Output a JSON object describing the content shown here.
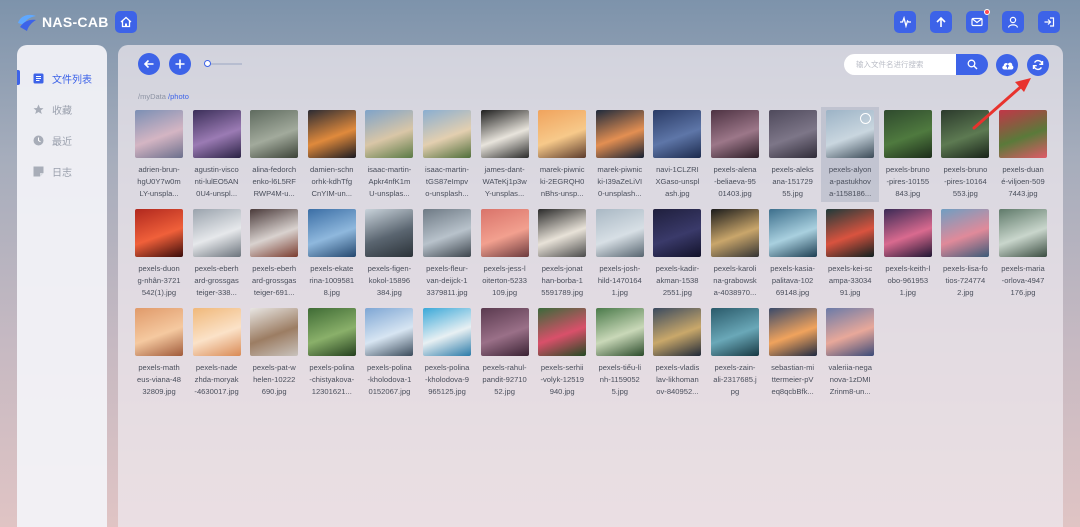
{
  "app": {
    "title": "NAS-CAB"
  },
  "sidebar": {
    "items": [
      {
        "label": "文件列表",
        "icon": "file-list-icon",
        "active": true
      },
      {
        "label": "收藏",
        "icon": "star-icon",
        "active": false
      },
      {
        "label": "最近",
        "icon": "clock-icon",
        "active": false
      },
      {
        "label": "日志",
        "icon": "log-icon",
        "active": false
      }
    ]
  },
  "toolbar": {
    "search_placeholder": "输入文件名进行搜索"
  },
  "breadcrumb": {
    "root": "/myData",
    "current": "/photo"
  },
  "colors": {
    "accent": "#3d63e8",
    "badge": "#ff4d4f"
  },
  "files": [
    {
      "name": "adrien-brun-hgU0Y7w0mLY-unsplash.jpg",
      "caption": [
        "adrien-brun-",
        "hgU0Y7w0m",
        "LY-unspla..."
      ],
      "colors": [
        "#7b8fb4",
        "#d4b5c3",
        "#6b6f8c"
      ]
    },
    {
      "name": "agustin-visconti-lulEO5AN0U4-unsplash.jpg",
      "caption": [
        "agustin-visco",
        "nti-lulEO5AN",
        "0U4-unspl..."
      ],
      "colors": [
        "#3b2f59",
        "#9b7bb4",
        "#2a2244"
      ]
    },
    {
      "name": "alina-fedorchenko-l6L5RFRWP4M-unsplash.jpg",
      "caption": [
        "alina-fedorch",
        "enko-l6L5RF",
        "RWP4M-u..."
      ],
      "colors": [
        "#5f6b5f",
        "#a2aa9c",
        "#3b4237"
      ]
    },
    {
      "name": "damien-schnorhk-kdhTfgCnYIM-unsplash.jpg",
      "caption": [
        "damien-schn",
        "orhk-kdhTfg",
        "CnYIM-un..."
      ],
      "colors": [
        "#2b2b33",
        "#e08a3c",
        "#1a1a22"
      ]
    },
    {
      "name": "isaac-martin-Apkr4nfK1mU-unsplash.jpg",
      "caption": [
        "isaac-martin-",
        "Apkr4nfK1m",
        "U-unsplas..."
      ],
      "colors": [
        "#7fa3c9",
        "#d9c6a7",
        "#5a7a45"
      ]
    },
    {
      "name": "isaac-martin-tGS87eImpvo-unsplash.jpg",
      "caption": [
        "isaac-martin-",
        "tGS87eImpv",
        "o-unsplash..."
      ],
      "colors": [
        "#8aaed1",
        "#e3cfb0",
        "#4f6e3a"
      ]
    },
    {
      "name": "james-dant-WATeKj1p3wY-unsplash.jpg",
      "caption": [
        "james-dant-",
        "WATeKj1p3w",
        "Y-unsplas..."
      ],
      "colors": [
        "#1f1f1f",
        "#e8e4dc",
        "#2a2a2a"
      ]
    },
    {
      "name": "marek-piwnicki-2EGRQH0nBhs-unsplash.jpg",
      "caption": [
        "marek-piwnic",
        "ki-2EGRQH0",
        "nBhs-unsp..."
      ],
      "colors": [
        "#f0a35d",
        "#f7c98a",
        "#5b3b2d"
      ]
    },
    {
      "name": "marek-piwnicki-I39aZeLiVI0-unsplash.jpg",
      "caption": [
        "marek-piwnic",
        "ki-I39aZeLiVI",
        "0-unsplash..."
      ],
      "colors": [
        "#1e2a3c",
        "#e38f52",
        "#152033"
      ]
    },
    {
      "name": "navi-1CLZRIXGaso-unsplash.jpg",
      "caption": [
        "navi-1CLZRI",
        "XGaso-unspl",
        "ash.jpg"
      ],
      "colors": [
        "#2a3b66",
        "#5e76a8",
        "#1c2a4d"
      ]
    },
    {
      "name": "pexels-alena-beliaeva-9501403.jpg",
      "caption": [
        "pexels-alena",
        "-beliaeva-95",
        "01403.jpg"
      ],
      "colors": [
        "#4d3242",
        "#9c7789",
        "#2c1d27"
      ]
    },
    {
      "name": "pexels-aleksana-15172955.jpg",
      "caption": [
        "pexels-aleks",
        "ana-151729",
        "55.jpg"
      ],
      "colors": [
        "#4f4a5c",
        "#7d7688",
        "#2f2b38"
      ]
    },
    {
      "name": "pexels-alyona-pastukhova-1158186.jpg",
      "caption": [
        "pexels-alyon",
        "a-pastukhov",
        "a-1158186..."
      ],
      "colors": [
        "#9cb3c6",
        "#c9d6df",
        "#3b4a57"
      ],
      "selected": true
    },
    {
      "name": "pexels-bruno-pires-10155843.jpg",
      "caption": [
        "pexels-bruno",
        "-pires-10155",
        "843.jpg"
      ],
      "colors": [
        "#2f4a2e",
        "#4f7a3f",
        "#1c2d1a"
      ]
    },
    {
      "name": "pexels-bruno-pires-10164553.jpg",
      "caption": [
        "pexels-bruno",
        "-pires-10164",
        "553.jpg"
      ],
      "colors": [
        "#2b3a2c",
        "#5d7a52",
        "#182319"
      ]
    },
    {
      "name": "pexels-duané-viljoen-5097443.jpg",
      "caption": [
        "pexels-duan",
        "é-viljoen-509",
        "7443.jpg"
      ],
      "colors": [
        "#c23648",
        "#5a7a3a",
        "#e05a68"
      ]
    },
    {
      "name": "pexels-duong-nhân-3721542(1).jpg",
      "caption": [
        "pexels-duon",
        "g-nhân-3721",
        "542(1).jpg"
      ],
      "colors": [
        "#b0281e",
        "#f0603a",
        "#3a0c0a"
      ]
    },
    {
      "name": "pexels-eberhard-grossgasteiger-338....jpg",
      "caption": [
        "pexels-eberh",
        "ard-grossgas",
        "teiger-338..."
      ],
      "colors": [
        "#9aa3ad",
        "#e6e8eb",
        "#6b737c"
      ]
    },
    {
      "name": "pexels-eberhard-grossgasteiger-691....jpg",
      "caption": [
        "pexels-eberh",
        "ard-grossgas",
        "teiger-691..."
      ],
      "colors": [
        "#4a3a3a",
        "#d9d2cf",
        "#7a3b2e"
      ]
    },
    {
      "name": "pexels-ekaterina-10095818.jpg",
      "caption": [
        "pexels-ekate",
        "rina-1009581",
        "8.jpg"
      ],
      "colors": [
        "#3b6ea5",
        "#8fb8dd",
        "#24476e"
      ]
    },
    {
      "name": "pexels-figen-kokol-15896384.jpg",
      "caption": [
        "pexels-figen-",
        "kokol-15896",
        "384.jpg"
      ],
      "colors": [
        "#c9d3db",
        "#5a6570",
        "#2b3238"
      ]
    },
    {
      "name": "pexels-fleur-van-deijck-13379811.jpg",
      "caption": [
        "pexels-fleur-",
        "van-deijck-1",
        "3379811.jpg"
      ],
      "colors": [
        "#6e7a85",
        "#b8c2cb",
        "#3c444c"
      ]
    },
    {
      "name": "pexels-jess-loiterton-5233109.jpg",
      "caption": [
        "pexels-jess-l",
        "oiterton-5233",
        "109.jpg"
      ],
      "colors": [
        "#d9736a",
        "#f2a08f",
        "#6b3a3d"
      ]
    },
    {
      "name": "pexels-jonathan-borba-15591789.jpg",
      "caption": [
        "pexels-jonat",
        "han-borba-1",
        "5591789.jpg"
      ],
      "colors": [
        "#2a2a2a",
        "#e8e2d8",
        "#4a4a4a"
      ]
    },
    {
      "name": "pexels-josh-hild-14701641.jpg",
      "caption": [
        "pexels-josh-",
        "hild-1470164",
        "1.jpg"
      ],
      "colors": [
        "#a9b8c4",
        "#d7dfe5",
        "#56646f"
      ]
    },
    {
      "name": "pexels-kadir-akman-15382551.jpg",
      "caption": [
        "pexels-kadir-",
        "akman-1538",
        "2551.jpg"
      ],
      "colors": [
        "#1f1f3d",
        "#3a3a6a",
        "#12122a"
      ]
    },
    {
      "name": "pexels-karolina-grabowska-4038970....jpg",
      "caption": [
        "pexels-karoli",
        "na-grabowsk",
        "a-4038970..."
      ],
      "colors": [
        "#1b1b1b",
        "#c9a66b",
        "#333"
      ]
    },
    {
      "name": "pexels-kasia-palitava-10269148.jpg",
      "caption": [
        "pexels-kasia-",
        "palitava-102",
        "69148.jpg"
      ],
      "colors": [
        "#3d6f8c",
        "#a9d0df",
        "#1d3e52"
      ]
    },
    {
      "name": "pexels-kei-scampa-3303491.jpg",
      "caption": [
        "pexels-kei-sc",
        "ampa-33034",
        "91.jpg"
      ],
      "colors": [
        "#1f3a3a",
        "#d9533f",
        "#0f2020"
      ]
    },
    {
      "name": "pexels-keith-lobo-9619531.jpg",
      "caption": [
        "pexels-keith-l",
        "obo-961953",
        "1.jpg"
      ],
      "colors": [
        "#3a2a55",
        "#d96a8f",
        "#1f1633"
      ]
    },
    {
      "name": "pexels-lisa-fotios-7247742.jpg",
      "caption": [
        "pexels-lisa-fo",
        "tios-724774",
        "2.jpg"
      ],
      "colors": [
        "#6f9ec2",
        "#e08a9a",
        "#3b5a78"
      ]
    },
    {
      "name": "pexels-maria-orlova-4947176.jpg",
      "caption": [
        "pexels-maria",
        "-orlova-4947",
        "176.jpg"
      ],
      "colors": [
        "#5f7a6a",
        "#c9d6cc",
        "#3a4c40"
      ]
    },
    {
      "name": "pexels-matheus-viana-4832809.jpg",
      "caption": [
        "pexels-math",
        "eus-viana-48",
        "32809.jpg"
      ],
      "colors": [
        "#e09a6a",
        "#f5c9a0",
        "#a05a3a"
      ]
    },
    {
      "name": "pexels-nadezhda-moryak-4630017.jpg",
      "caption": [
        "pexels-nade",
        "zhda-moryak",
        "-4630017.jpg"
      ],
      "colors": [
        "#f0b87a",
        "#fbe2c8",
        "#d98a55"
      ]
    },
    {
      "name": "pexels-pat-whelen-10222690.jpg",
      "caption": [
        "pexels-pat-w",
        "helen-10222",
        "690.jpg"
      ],
      "colors": [
        "#e8e6e3",
        "#9c7d63",
        "#c9c3bd"
      ]
    },
    {
      "name": "pexels-polina-chistyakova-12301621....jpg",
      "caption": [
        "pexels-polina",
        "-chistyakova-",
        "12301621..."
      ],
      "colors": [
        "#3f6b35",
        "#8ab06a",
        "#243f1e"
      ]
    },
    {
      "name": "pexels-polina-kholodova-10152067.jpg",
      "caption": [
        "pexels-polina",
        "-kholodova-1",
        "0152067.jpg"
      ],
      "colors": [
        "#7ea6d4",
        "#d7e5f2",
        "#3a4a5a"
      ]
    },
    {
      "name": "pexels-polina-kholodova-9965125.jpg",
      "caption": [
        "pexels-polina",
        "-kholodova-9",
        "965125.jpg"
      ],
      "colors": [
        "#3aa8d8",
        "#e8f0f3",
        "#2a7aa8"
      ]
    },
    {
      "name": "pexels-rahul-pandit-9271052.jpg",
      "caption": [
        "pexels-rahul-",
        "pandit-92710",
        "52.jpg"
      ],
      "colors": [
        "#5a3a4f",
        "#9a7088",
        "#3a2233"
      ]
    },
    {
      "name": "pexels-serhii-volyk-12519940.jpg",
      "caption": [
        "pexels-serhii",
        "-volyk-12519",
        "940.jpg"
      ],
      "colors": [
        "#3a6a3a",
        "#d9506a",
        "#234a23"
      ]
    },
    {
      "name": "pexels-tiểu-linh-11590525.jpg",
      "caption": [
        "pexels-tiểu-li",
        "nh-1159052",
        "5.jpg"
      ],
      "colors": [
        "#4a7a4a",
        "#c9d8b8",
        "#2a4a2a"
      ]
    },
    {
      "name": "pexels-vladislav-likhomanov-840952....jpg",
      "caption": [
        "pexels-vladis",
        "lav-likhoman",
        "ov-840952..."
      ],
      "colors": [
        "#3a4a5f",
        "#c9a86a",
        "#1f2838"
      ]
    },
    {
      "name": "pexels-zain-ali-2317685.jpg",
      "caption": [
        "pexels-zain-",
        "ali-2317685.j",
        "pg"
      ],
      "colors": [
        "#2a5a6a",
        "#6aa8b8",
        "#173842"
      ]
    },
    {
      "name": "sebastian-mittermeier-pVeq8qcbBfk-....jpg",
      "caption": [
        "sebastian-mi",
        "ttermeier-pV",
        "eq8qcbBfk..."
      ],
      "colors": [
        "#3a4a6a",
        "#f0a35d",
        "#1f2a42"
      ]
    },
    {
      "name": "valeriia-neganova-1zDMIZrinm8-un....jpg",
      "caption": [
        "valeriia-nega",
        "nova-1zDMI",
        "Zrinm8-un..."
      ],
      "colors": [
        "#6a7aa8",
        "#e8a89a",
        "#3a4a78"
      ]
    }
  ]
}
